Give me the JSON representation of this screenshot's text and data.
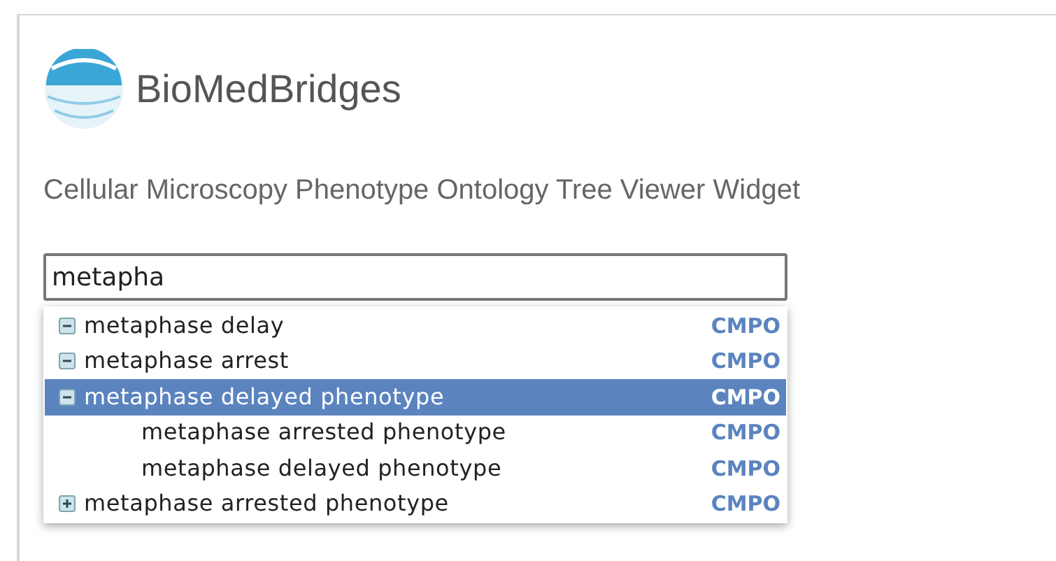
{
  "logo": {
    "text": "BioMedBridges"
  },
  "title": "Cellular Microscopy Phenotype Ontology Tree Viewer Widget",
  "search": {
    "value": "metapha"
  },
  "results": [
    {
      "label": "metaphase delay",
      "source": "CMPO",
      "expanded": true,
      "selected": false
    },
    {
      "label": "metaphase arrest",
      "source": "CMPO",
      "expanded": true,
      "selected": false
    },
    {
      "label": "metaphase delayed phenotype",
      "source": "CMPO",
      "expanded": true,
      "selected": true,
      "children": [
        {
          "label": "metaphase arrested phenotype",
          "source": "CMPO",
          "selected": false
        },
        {
          "label": "metaphase delayed phenotype",
          "source": "CMPO",
          "selected": false
        }
      ]
    },
    {
      "label": "metaphase arrested phenotype",
      "source": "CMPO",
      "expanded": false,
      "selected": false
    }
  ]
}
